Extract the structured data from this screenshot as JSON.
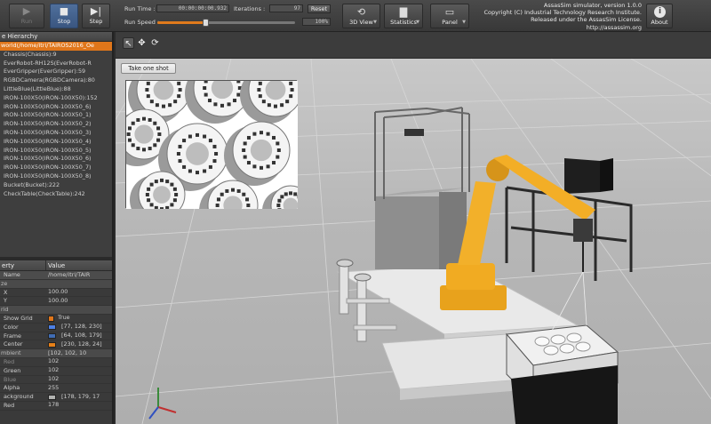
{
  "toolbar": {
    "run_label": "Run",
    "stop_label": "Stop",
    "step_label": "Step",
    "run_time_label": "Run Time :",
    "run_time_value": "00:00:00:00.932",
    "iterations_label": "Iterations :",
    "iterations_value": "97",
    "reset_label": "Reset",
    "run_speed_label": "Run Speed :",
    "run_speed_percent": "100%",
    "run_speed_fraction": 0.35,
    "view3d_label": "3D View",
    "statistics_label": "Statistics",
    "panel_label": "Panel",
    "about_label": "About"
  },
  "copyright": {
    "line1": "AssasSim simulator, version 1.0.0",
    "line2": "Copyright (C) Industrial Technology Research Institute.",
    "line3": "Released under the AssasSim License.",
    "line4": "http://assassim.org"
  },
  "hierarchy": {
    "title": "e Hierarchy",
    "items": [
      "world(/home/itri/TAIROS2016_Oe",
      "Chassis(Chassis):9",
      "EverRobot-RH12S(EverRobot-R",
      "EverGripper(EverGripper):59",
      "RGBDCamera(RGBDCamera):80",
      "LittleBlue(LittleBlue):88",
      "IRON-100X50(IRON-100X50):152",
      "IRON-100X50(IRON-100X50_6)",
      "IRON-100X50(IRON-100X50_1)",
      "IRON-100X50(IRON-100X50_2)",
      "IRON-100X50(IRON-100X50_3)",
      "IRON-100X50(IRON-100X50_4)",
      "IRON-100X50(IRON-100X50_5)",
      "IRON-100X50(IRON-100X50_6)",
      "IRON-100X50(IRON-100X50_7)",
      "IRON-100X50(IRON-100X50_8)",
      "Bucket(Bucket):222",
      "CheckTable(CheckTable):242"
    ]
  },
  "properties": {
    "col_property": "erty",
    "col_value": "Value",
    "rows": [
      {
        "k": "Name",
        "v": "/home/itri/TAIR",
        "type": "hl"
      },
      {
        "k": "ze",
        "v": "",
        "type": "group"
      },
      {
        "k": "X",
        "v": "100.00",
        "type": ""
      },
      {
        "k": "Y",
        "v": "100.00",
        "type": ""
      },
      {
        "k": "rid",
        "v": "",
        "type": "group"
      },
      {
        "k": "Show Grid",
        "v": "True",
        "type": "check"
      },
      {
        "k": "Color",
        "v": "[77, 128, 230]",
        "type": "swatch",
        "color": "#4d80e6"
      },
      {
        "k": "Frame",
        "v": "[64, 108, 179]",
        "type": "swatch",
        "color": "#406cb3"
      },
      {
        "k": "Center",
        "v": "[230, 128, 24]",
        "type": "swatch",
        "color": "#e68018"
      },
      {
        "k": "mbient",
        "v": "[102, 102, 10",
        "type": "group"
      },
      {
        "k": "Red",
        "v": "102",
        "type": "dim"
      },
      {
        "k": "Green",
        "v": "102",
        "type": ""
      },
      {
        "k": "Blue",
        "v": "102",
        "type": "dim"
      },
      {
        "k": "Alpha",
        "v": "255",
        "type": ""
      },
      {
        "k": "ackground",
        "v": "[178, 179, 17",
        "type": "swatch",
        "color": "#b2b3b1"
      },
      {
        "k": "Red",
        "v": "178",
        "type": ""
      }
    ]
  },
  "viewport": {
    "take_shot_label": "Take one shot"
  },
  "colors": {
    "accent": "#e0761a",
    "stop_blue": "#4f6f9c",
    "robot_yellow": "#f2a81d",
    "floor": "#c2c2c2"
  }
}
